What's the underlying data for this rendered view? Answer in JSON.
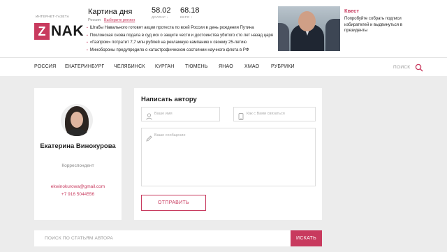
{
  "header": {
    "logo_tagline": "ИНТЕРНЕТ-ГАЗЕТА",
    "logo_letter": "Z",
    "logo_text": "NAK",
    "picture_of_day": "Картина дня",
    "location": "Россия",
    "choose_region": "Выберите регион",
    "rates": [
      {
        "value": "58.02",
        "label": "ДОЛЛАР ↓"
      },
      {
        "value": "68.18",
        "label": "ЕВРО ↑"
      }
    ],
    "news": [
      "Штабы Навального готовят акции протеста по всей России в день рождения Путина",
      "Поклонская снова подала в суд иск о защите чести и достоинства убитого сто лет назад царя",
      "«Газпром» потратит 7,7 млн рублей на рекламную кампанию к своему 25-летию",
      "Минобороны предупредило о катастрофическом состоянии научного флота в РФ"
    ],
    "quest_title": "Квест",
    "quest_text": "Попробуйте собрать подписи избирателей и выдвинуться в президенты"
  },
  "nav": {
    "items": [
      "РОССИЯ",
      "ЕКАТЕРИНБУРГ",
      "ЧЕЛЯБИНСК",
      "КУРГАН",
      "ТЮМЕНЬ",
      "ЯНАО",
      "ХМАО",
      "РУБРИКИ"
    ],
    "search_label": "ПОИСК"
  },
  "author": {
    "name": "Екатерина Винокурова",
    "role": "Корреспондент",
    "email": "ekwinokurowa@gmail.com",
    "phone": "+7 916 5044556"
  },
  "form": {
    "title": "Написать автору",
    "name_placeholder": "Ваше имя",
    "contact_placeholder": "Как с Вами связаться",
    "message_placeholder": "Ваше сообщение",
    "send_label": "ОТПРАВИТЬ"
  },
  "search": {
    "placeholder": "ПОИСК ПО СТАТЬЯМ АВТОРА",
    "button_label": "ИСКАТЬ"
  },
  "colors": {
    "accent": "#c83a5e",
    "background": "#ececec"
  }
}
